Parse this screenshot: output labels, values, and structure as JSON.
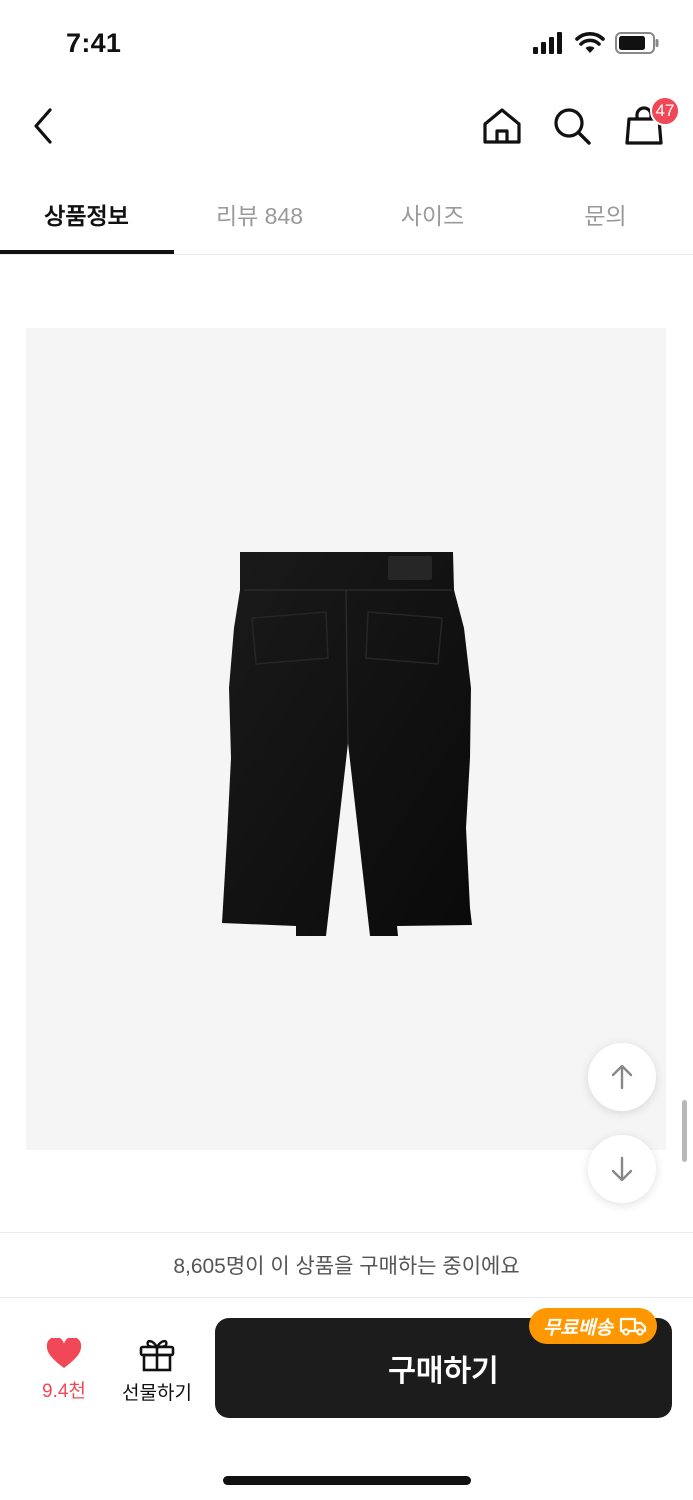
{
  "status_bar": {
    "time": "7:41"
  },
  "header": {
    "cart_count": "47"
  },
  "tabs": [
    {
      "label": "상품정보",
      "active": true
    },
    {
      "label": "리뷰 848",
      "active": false
    },
    {
      "label": "사이즈",
      "active": false
    },
    {
      "label": "문의",
      "active": false
    }
  ],
  "buyers_banner": "8,605명이 이 상품을 구매하는 중이에요",
  "bottom_bar": {
    "like_count": "9.4천",
    "gift_label": "선물하기",
    "buy_label": "구매하기",
    "free_shipping_label": "무료배송"
  },
  "colors": {
    "accent_red": "#f04856",
    "free_shipping_orange": "#ff9800",
    "buy_button": "#1c1c1c"
  },
  "icons": [
    "back-icon",
    "home-icon",
    "search-icon",
    "cart-icon",
    "heart-icon",
    "gift-icon",
    "truck-icon",
    "arrow-up-icon",
    "arrow-down-icon"
  ]
}
